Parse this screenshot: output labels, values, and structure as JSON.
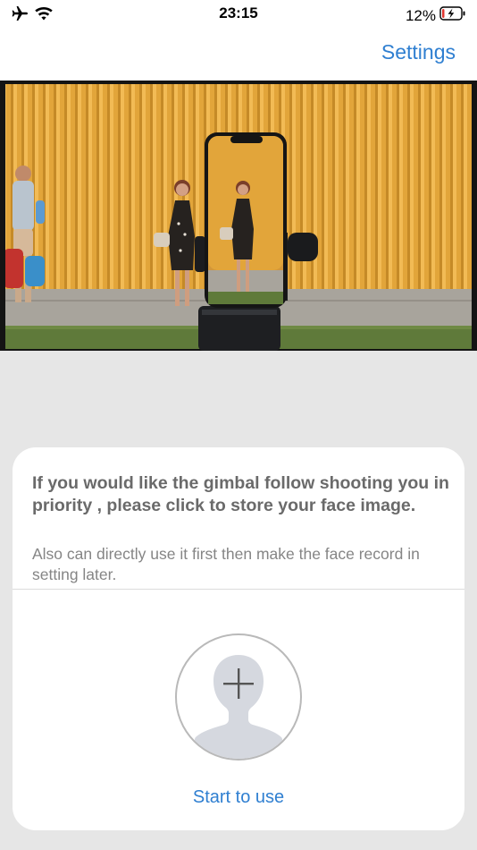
{
  "status_bar": {
    "time": "23:15",
    "battery_percent": "12%",
    "battery_level": 0.12,
    "icons": [
      "airplane-icon",
      "wifi-icon",
      "battery-charging-icon"
    ]
  },
  "nav": {
    "settings_label": "Settings"
  },
  "hero": {
    "image": "person-tracking-gimbal-photo"
  },
  "card": {
    "title": "If you would like the gimbal follow shooting you in priority , please click to store your face image.",
    "subtitle": "Also can directly use it first then make the face record in setting later.",
    "face_button_icon": "add-face-icon",
    "start_label": "Start to use"
  },
  "colors": {
    "accent": "#2f7fd1",
    "background": "#e6e6e6",
    "card": "#ffffff",
    "title_text": "#6a6a6a",
    "subtitle_text": "#858585",
    "silhouette": "#d5d8df"
  }
}
